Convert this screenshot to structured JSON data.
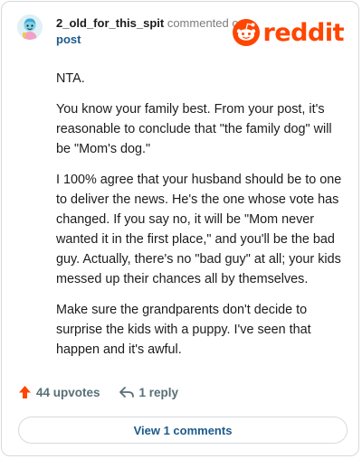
{
  "comment": {
    "username": "2_old_for_this_spit",
    "action_text": "commented on",
    "post_link": "post",
    "paragraphs": [
      "NTA.",
      "You know your family best. From your post, it's reasonable to conclude that \"the family dog\" will be \"Mom's dog.\"",
      "I 100% agree that your husband should be to one to deliver the news. He's the one whose vote has changed. If you say no, it will be \"Mom never wanted it in the first place,\" and you'll be the bad guy. Actually, there's no \"bad guy\" at all; your kids messed up their chances all by themselves.",
      "Make sure the grandparents don't decide to surprise the kids with a puppy. I've seen that happen and it's awful."
    ]
  },
  "brand": {
    "logo_text": "reddit",
    "color": "#ff4500"
  },
  "footer": {
    "upvotes_label": "44 upvotes",
    "reply_label": "1 reply",
    "view_comments_label": "View 1 comments"
  },
  "icons": {
    "upvote": "upvote-arrow-icon",
    "reply": "reply-arrow-icon",
    "logo": "reddit-snoo-icon",
    "avatar": "user-avatar-icon"
  }
}
